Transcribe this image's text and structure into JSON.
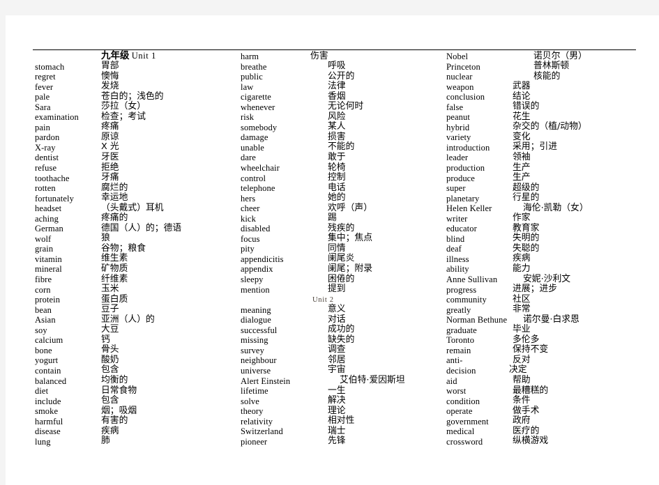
{
  "document": {
    "title_cn": "九年级",
    "title_en": "Unit 1",
    "sub_unit": "Unit 2"
  },
  "columns": [
    {
      "id": "column-1",
      "entries": [
        {
          "en": "stomach",
          "zh": "胃部"
        },
        {
          "en": "regret",
          "zh": "懊悔"
        },
        {
          "en": "fever",
          "zh": "发烧"
        },
        {
          "en": "pale",
          "zh": "苍白的；浅色的"
        },
        {
          "en": "Sara",
          "zh": "莎拉（女）"
        },
        {
          "en": "examination",
          "zh": "检查；考试"
        },
        {
          "en": "pain",
          "zh": "疼痛"
        },
        {
          "en": "pardon",
          "zh": "原谅"
        },
        {
          "en": "X-ray",
          "zh": "X 光"
        },
        {
          "en": "dentist",
          "zh": "牙医"
        },
        {
          "en": "refuse",
          "zh": "拒绝"
        },
        {
          "en": "toothache",
          "zh": "牙痛"
        },
        {
          "en": "rotten",
          "zh": "腐烂的"
        },
        {
          "en": "fortunately",
          "zh": "幸运地"
        },
        {
          "en": "headset",
          "zh": "（头戴式）耳机"
        },
        {
          "en": "aching",
          "zh": "疼痛的"
        },
        {
          "en": "German",
          "zh": "德国（人）的；德语"
        },
        {
          "en": "wolf",
          "zh": "狼"
        },
        {
          "en": "grain",
          "zh": "谷物；粮食"
        },
        {
          "en": "vitamin",
          "zh": "维生素"
        },
        {
          "en": "mineral",
          "zh": "矿物质"
        },
        {
          "en": "fibre",
          "zh": "纤维素"
        },
        {
          "en": "corn",
          "zh": "玉米"
        },
        {
          "en": "protein",
          "zh": "蛋白质"
        },
        {
          "en": "bean",
          "zh": "豆子"
        },
        {
          "en": "Asian",
          "zh": "亚洲（人）的"
        },
        {
          "en": "soy",
          "zh": "大豆"
        },
        {
          "en": "calcium",
          "zh": "钙"
        },
        {
          "en": "bone",
          "zh": "骨头"
        },
        {
          "en": "yogurt",
          "zh": "酸奶"
        },
        {
          "en": "contain",
          "zh": "包含"
        },
        {
          "en": "balanced",
          "zh": "均衡的"
        },
        {
          "en": "diet",
          "zh": "日常食物"
        },
        {
          "en": "include",
          "zh": "包含"
        },
        {
          "en": "smoke",
          "zh": "烟；吸烟"
        },
        {
          "en": "harmful",
          "zh": "有害的"
        },
        {
          "en": "disease",
          "zh": "疾病"
        },
        {
          "en": "lung",
          "zh": "肺"
        }
      ]
    },
    {
      "id": "column-2",
      "entries": [
        {
          "en": "harm",
          "zh": "伤害",
          "shift": "shift-l-25"
        },
        {
          "en": "breathe",
          "zh": "呼吸"
        },
        {
          "en": "public",
          "zh": "公开的"
        },
        {
          "en": "law",
          "zh": "法律"
        },
        {
          "en": "cigarette",
          "zh": "香烟"
        },
        {
          "en": "whenever",
          "zh": "无论何时"
        },
        {
          "en": "risk",
          "zh": "风险"
        },
        {
          "en": "somebody",
          "zh": "某人"
        },
        {
          "en": "damage",
          "zh": "损害"
        },
        {
          "en": "unable",
          "zh": "不能的"
        },
        {
          "en": "dare",
          "zh": "敢于"
        },
        {
          "en": "wheelchair",
          "zh": "轮椅"
        },
        {
          "en": "control",
          "zh": "控制"
        },
        {
          "en": "telephone",
          "zh": "电话"
        },
        {
          "en": "hers",
          "zh": "她的"
        },
        {
          "en": "cheer",
          "zh": "欢呼（声）"
        },
        {
          "en": "kick",
          "zh": "踢"
        },
        {
          "en": "disabled",
          "zh": "残疾的"
        },
        {
          "en": "focus",
          "zh": "集中；焦点"
        },
        {
          "en": "pity",
          "zh": "同情"
        },
        {
          "en": "appendicitis",
          "zh": "阑尾炎"
        },
        {
          "en": "appendix",
          "zh": "阑尾；附录"
        },
        {
          "en": "sleepy",
          "zh": "困倦的"
        },
        {
          "en": "mention",
          "zh": "提到"
        },
        {
          "type": "subunit"
        },
        {
          "en": "meaning",
          "zh": "意义"
        },
        {
          "en": "dialogue",
          "zh": "对话"
        },
        {
          "en": "successful",
          "zh": "成功的"
        },
        {
          "en": "missing",
          "zh": "缺失的"
        },
        {
          "en": "survey",
          "zh": "调查"
        },
        {
          "en": "neighbour",
          "zh": "邻居"
        },
        {
          "en": "universe",
          "zh": "宇宙"
        },
        {
          "en": "Alert Einstein",
          "zh": "艾伯特·爱因斯坦",
          "shift": "inline-name"
        },
        {
          "en": "lifetime",
          "zh": "一生"
        },
        {
          "en": "solve",
          "zh": "解决"
        },
        {
          "en": "theory",
          "zh": "理论"
        },
        {
          "en": "relativity",
          "zh": "相对性"
        },
        {
          "en": "Switzerland",
          "zh": "瑞士"
        },
        {
          "en": "pioneer",
          "zh": "先锋"
        }
      ]
    },
    {
      "id": "column-3",
      "entries": [
        {
          "en": "Nobel",
          "zh": "诺贝尔（男）",
          "shift": "shift-r-30"
        },
        {
          "en": "Princeton",
          "zh": "普林斯顿",
          "shift": "shift-r-30"
        },
        {
          "en": "nuclear",
          "zh": "核能的",
          "shift": "shift-r-30"
        },
        {
          "en": "weapon",
          "zh": "武器"
        },
        {
          "en": "conclusion",
          "zh": "结论"
        },
        {
          "en": "false",
          "zh": "错误的"
        },
        {
          "en": "peanut",
          "zh": "花生"
        },
        {
          "en": "hybrid",
          "zh": "杂交的（植/动物）"
        },
        {
          "en": "variety",
          "zh": "变化"
        },
        {
          "en": "introduction",
          "zh": "采用；引进"
        },
        {
          "en": "leader",
          "zh": "领袖"
        },
        {
          "en": "production",
          "zh": "生产"
        },
        {
          "en": "produce",
          "zh": "生产"
        },
        {
          "en": "super",
          "zh": "超级的"
        },
        {
          "en": "planetary",
          "zh": "行星的"
        },
        {
          "en": "Helen Keller",
          "zh": "海伦·凯勒（女）",
          "shift": "inline-name-c3"
        },
        {
          "en": "writer",
          "zh": "作家"
        },
        {
          "en": "educator",
          "zh": "教育家"
        },
        {
          "en": "blind",
          "zh": "失明的"
        },
        {
          "en": "deaf",
          "zh": "失聪的"
        },
        {
          "en": "illness",
          "zh": "疾病"
        },
        {
          "en": "ability",
          "zh": "能力"
        },
        {
          "en": "Anne Sullivan",
          "zh": "安妮·沙利文",
          "shift": "inline-name-c3"
        },
        {
          "en": "progress",
          "zh": "进展；进步"
        },
        {
          "en": "community",
          "zh": "社区"
        },
        {
          "en": "greatly",
          "zh": "非常"
        },
        {
          "en": "Norman Bethune",
          "zh": "诺尔曼·白求恩",
          "shift": "inline-name-c3"
        },
        {
          "en": "graduate",
          "zh": "毕业"
        },
        {
          "en": "Toronto",
          "zh": "多伦多"
        },
        {
          "en": "remain",
          "zh": "保持不变"
        },
        {
          "en": "anti-",
          "zh": "反对"
        },
        {
          "en": "decision",
          "zh": "决定",
          "shift": "shift-l-5"
        },
        {
          "en": "aid",
          "zh": "帮助"
        },
        {
          "en": "worst",
          "zh": "最糟糕的"
        },
        {
          "en": "condition",
          "zh": "条件"
        },
        {
          "en": "operate",
          "zh": "做手术"
        },
        {
          "en": "government",
          "zh": "政府"
        },
        {
          "en": "medical",
          "zh": "医疗的"
        },
        {
          "en": "crossword",
          "zh": "纵横游戏"
        }
      ]
    }
  ]
}
